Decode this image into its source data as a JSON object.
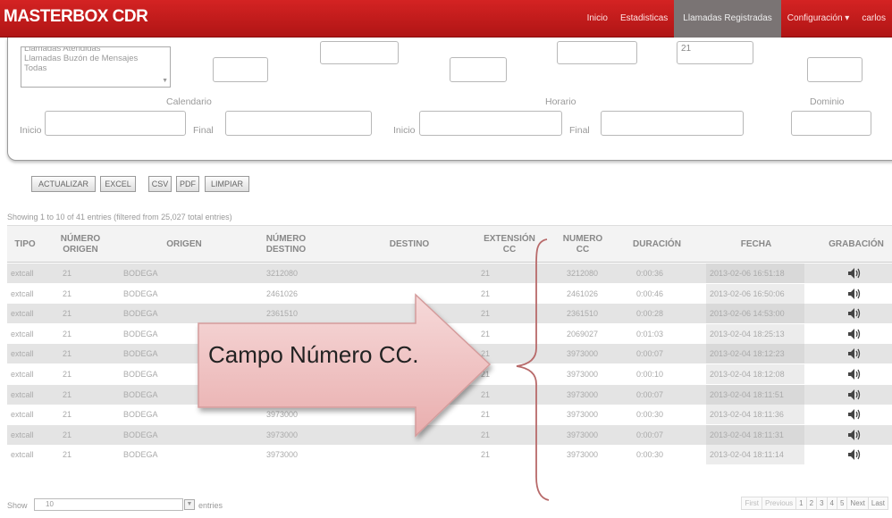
{
  "navbar": {
    "brand": "MASTERBOX CDR",
    "items": [
      "Inicio",
      "Estadisticas",
      "Llamadas Registradas",
      "Configuración ▾",
      "carlos"
    ]
  },
  "filters": {
    "listbox_options": [
      "Llamadas Atendidas",
      "Llamadas Buzón de Mensajes",
      "Todas"
    ],
    "top_field_value": "21",
    "calendario_label": "Calendario",
    "horario_label": "Horario",
    "dominio_label": "Dominio",
    "inicio_label": "Inicio",
    "final_label": "Final"
  },
  "buttons": [
    "ACTUALIZAR",
    "EXCEL",
    "CSV",
    "PDF",
    "LIMPIAR"
  ],
  "showing_text": "Showing 1 to 10 of 41 entries (filtered from 25,027 total entries)",
  "table": {
    "headers": [
      "TIPO",
      "NÚMERO ORIGEN",
      "ORIGEN",
      "NÚMERO DESTINO",
      "DESTINO",
      "EXTENSIÓN CC",
      "NUMERO CC",
      "DURACIÓN",
      "FECHA",
      "GRABACIÓN"
    ],
    "rows": [
      [
        "extcall",
        "21",
        "BODEGA",
        "3212080",
        "",
        "21",
        "3212080",
        "0:00:36",
        "2013-02-06 16:51:18"
      ],
      [
        "extcall",
        "21",
        "BODEGA",
        "2461026",
        "",
        "21",
        "2461026",
        "0:00:46",
        "2013-02-06 16:50:06"
      ],
      [
        "extcall",
        "21",
        "BODEGA",
        "2361510",
        "",
        "21",
        "2361510",
        "0:00:28",
        "2013-02-06 14:53:00"
      ],
      [
        "extcall",
        "21",
        "BODEGA",
        "2069027",
        "",
        "21",
        "2069027",
        "0:01:03",
        "2013-02-04 18:25:13"
      ],
      [
        "extcall",
        "21",
        "BODEGA",
        "3973000",
        "",
        "21",
        "3973000",
        "0:00:07",
        "2013-02-04 18:12:23"
      ],
      [
        "extcall",
        "21",
        "BODEGA",
        "3973000",
        "",
        "21",
        "3973000",
        "0:00:10",
        "2013-02-04 18:12:08"
      ],
      [
        "extcall",
        "21",
        "BODEGA",
        "3973000",
        "",
        "21",
        "3973000",
        "0:00:07",
        "2013-02-04 18:11:51"
      ],
      [
        "extcall",
        "21",
        "BODEGA",
        "3973000",
        "",
        "21",
        "3973000",
        "0:00:30",
        "2013-02-04 18:11:36"
      ],
      [
        "extcall",
        "21",
        "BODEGA",
        "3973000",
        "",
        "21",
        "3973000",
        "0:00:07",
        "2013-02-04 18:11:31"
      ],
      [
        "extcall",
        "21",
        "BODEGA",
        "3973000",
        "",
        "21",
        "3973000",
        "0:00:30",
        "2013-02-04 18:11:14"
      ]
    ],
    "recording_icon": "speaker-icon"
  },
  "footer": {
    "show_label": "Show",
    "show_value": "10",
    "entries_label": "entries",
    "pager": [
      "First",
      "Previous",
      "1",
      "2",
      "3",
      "4",
      "5",
      "Next",
      "Last"
    ]
  },
  "annotation": {
    "text": "Campo Número CC."
  },
  "colors": {
    "navbar": "#c41a1a",
    "active_tab": "#7a7474",
    "row_stripe": "#e4e4e4",
    "callout_fill": "#f3c8c8"
  }
}
